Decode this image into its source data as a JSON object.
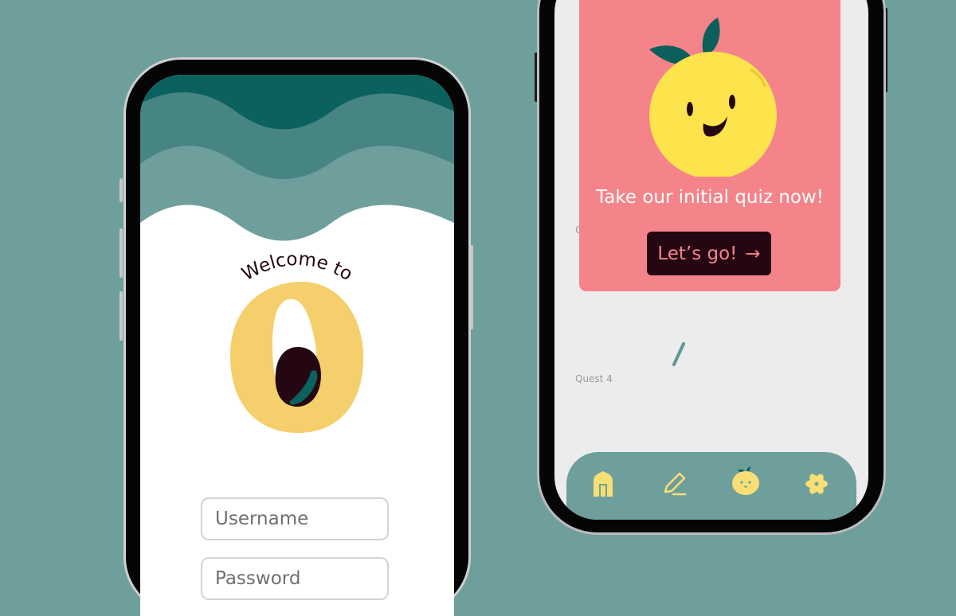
{
  "login": {
    "welcome_text": "Welcome to",
    "username_placeholder": "Username",
    "password_placeholder": "Password"
  },
  "quests": {
    "partial_label": "Q",
    "quest4_label": "Quest 4"
  },
  "quiz_card": {
    "prompt": "Take our initial quiz now!",
    "button_label": "Let’s go!",
    "button_arrow": "→"
  },
  "nav": {
    "items": [
      {
        "icon": "home-icon"
      },
      {
        "icon": "pencil-icon"
      },
      {
        "icon": "lemon-face-icon"
      },
      {
        "icon": "atom-icon"
      }
    ]
  },
  "colors": {
    "background": "#6e9f9c",
    "wave_dark": "#0b615d",
    "wave_mid": "#478583",
    "wave_light": "#6e9f9c",
    "logo_yellow": "#f4cf6b",
    "dark_maroon": "#250713",
    "card_pink": "#f5838a",
    "lemon_yellow": "#fde34c",
    "leaf_green": "#0d5f5b",
    "nav_icon_yellow": "#f7df75"
  }
}
